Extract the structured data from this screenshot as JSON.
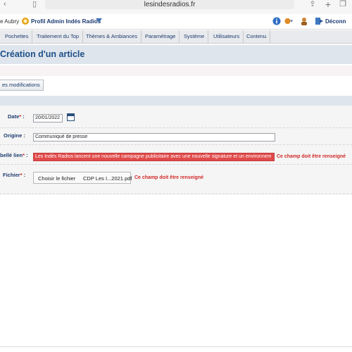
{
  "browser": {
    "url": "lesindesradios.fr"
  },
  "header": {
    "user_name": "e Aubry",
    "profile_label": "Profil Admin Indés Radios",
    "logout_label": "Déconn"
  },
  "nav": {
    "items": [
      {
        "label": "Pochettes"
      },
      {
        "label": "Traitement du Top"
      },
      {
        "label": "Thèmes & Ambiances"
      },
      {
        "label": "Paramétrage"
      },
      {
        "label": "Système"
      },
      {
        "label": "Utilisateurs"
      },
      {
        "label": "Contenu"
      }
    ]
  },
  "page": {
    "title": "Création d'un article",
    "modifs_button": "es modifications"
  },
  "form": {
    "date": {
      "label": "Date",
      "value": "20/01/2022"
    },
    "origine": {
      "label": "Origine :",
      "value": "Communiqué de presse"
    },
    "libelle": {
      "label": "bellé lien",
      "value": "Les Indés Radios lancent une nouvelle campagne publicitaire avec une nouvelle signature et un environnem",
      "error": "Ce champ doit être renseigné"
    },
    "fichier": {
      "label": "Fichier",
      "button": "Choisir le fichier",
      "filename": "CDP Les I...2021.pdf",
      "error": "Ce champ doit être renseigné"
    },
    "required_mark": "*",
    "colon": " :"
  },
  "colors": {
    "accent": "#1d4f88",
    "error": "#d12a2a",
    "error_field": "#e04a4a"
  }
}
